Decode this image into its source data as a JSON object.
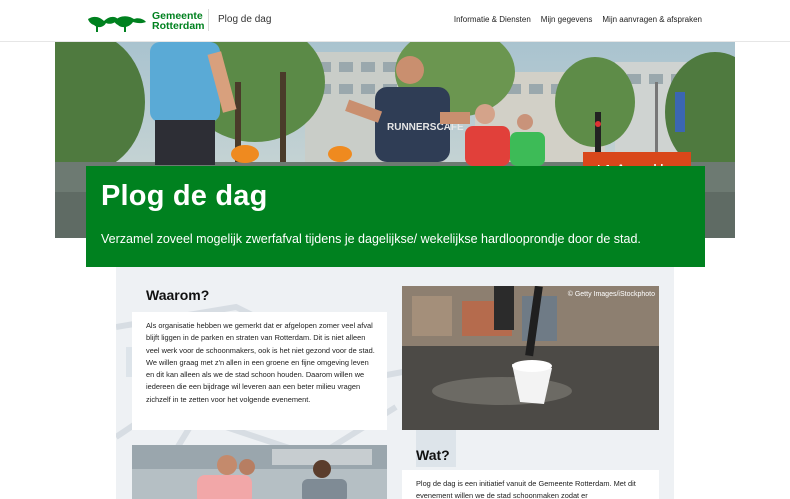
{
  "header": {
    "brand_line1": "Gemeente",
    "brand_line2": "Rotterdam",
    "subtitle": "Plog de dag",
    "nav": [
      {
        "label": "Informatie & Diensten"
      },
      {
        "label": "Mijn gegevens"
      },
      {
        "label": "Mijn aanvragen & afspraken"
      }
    ]
  },
  "hero": {
    "cta_label": "Aanmelden",
    "cta_icon": "mail-icon",
    "title": "Plog de dag",
    "subtitle": "Verzamel zoveel mogelijk zwerfafval tijdens je dagelijkse/ wekelijkse hardlooprondje door de stad."
  },
  "waarom": {
    "title": "Waarom?",
    "body": "Als organisatie hebben we gemerkt dat er afgelopen zomer veel afval blijft liggen in de parken en straten van Rotterdam. Dit is niet alleen veel werk voor de schoonmakers, ook is het niet gezond voor de stad. We willen graag met z'n allen in een groene en fijne omgeving leven en dit kan alleen als we de stad schoon houden. Daarom willen we iedereen die een bijdrage wil leveren aan een beter milieu vragen zichzelf in te zetten voor het volgende evenement.",
    "photo_credit": "© Getty Images/iStockphoto"
  },
  "wat": {
    "title": "Wat?",
    "body": "Plog de dag is een initiatief vanuit de Gemeente Rotterdam. Met dit evenement willen we de stad schoonmaken zodat er"
  },
  "colors": {
    "brand_green": "#00811f",
    "cta_orange": "#d9471a"
  }
}
